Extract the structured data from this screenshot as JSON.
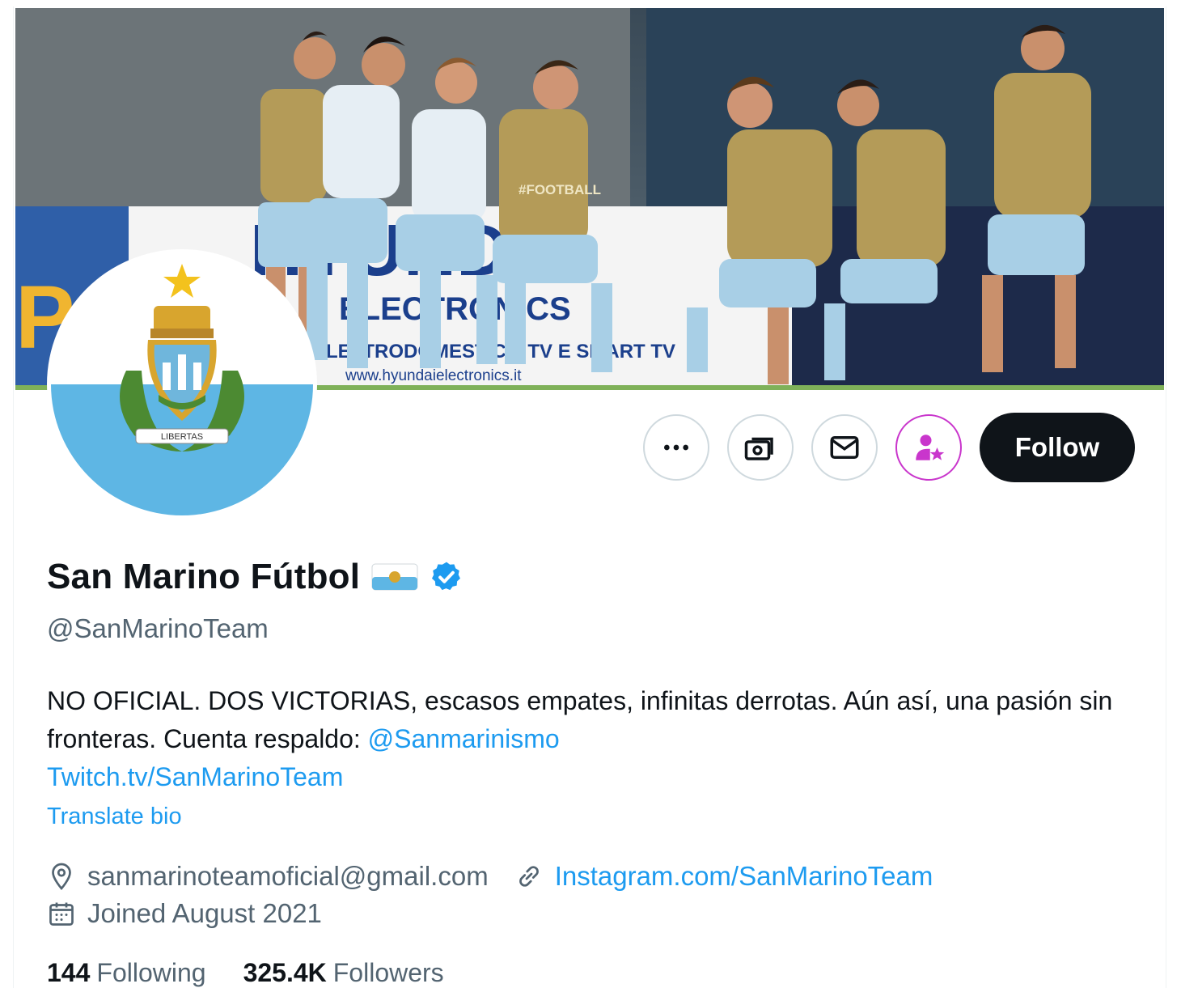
{
  "profile": {
    "display_name": "San Marino Fútbol",
    "handle": "@SanMarinoTeam",
    "bio_text": "NO OFICIAL. DOS VICTORIAS, escasos empates, infinitas derrotas. Aún así, una pasión sin fronteras. Cuenta respaldo: ",
    "bio_mention": "@Sanmarinismo",
    "bio_link": "Twitch.tv/SanMarinoTeam",
    "translate_label": "Translate bio",
    "location": "sanmarinoteamoficial@gmail.com",
    "website": "Instagram.com/SanMarinoTeam",
    "joined": "Joined August 2021",
    "following_count": "144",
    "following_label": "Following",
    "followers_count": "325.4K",
    "followers_label": "Followers"
  },
  "actions": {
    "follow_label": "Follow"
  },
  "banner": {
    "board_text_1": "ELECTRONICS",
    "board_text_2": "ELETTRODOMESTICI | TV E SMART TV",
    "board_text_3": "www.hyundaielectronics.it",
    "bib_text": "#FOOTBALL"
  },
  "avatar": {
    "motto": "LIBERTAS"
  },
  "colors": {
    "accent": "#1d9bf0",
    "follow_bg": "#0f1419",
    "subscribe": "#c936cc",
    "flag_blue": "#5eb6e4",
    "muted": "#536471"
  },
  "icons": [
    "more-icon",
    "tip-icon",
    "message-icon",
    "subscribe-icon",
    "verified-icon",
    "flag-emoji-icon",
    "location-icon",
    "link-icon",
    "calendar-icon"
  ]
}
